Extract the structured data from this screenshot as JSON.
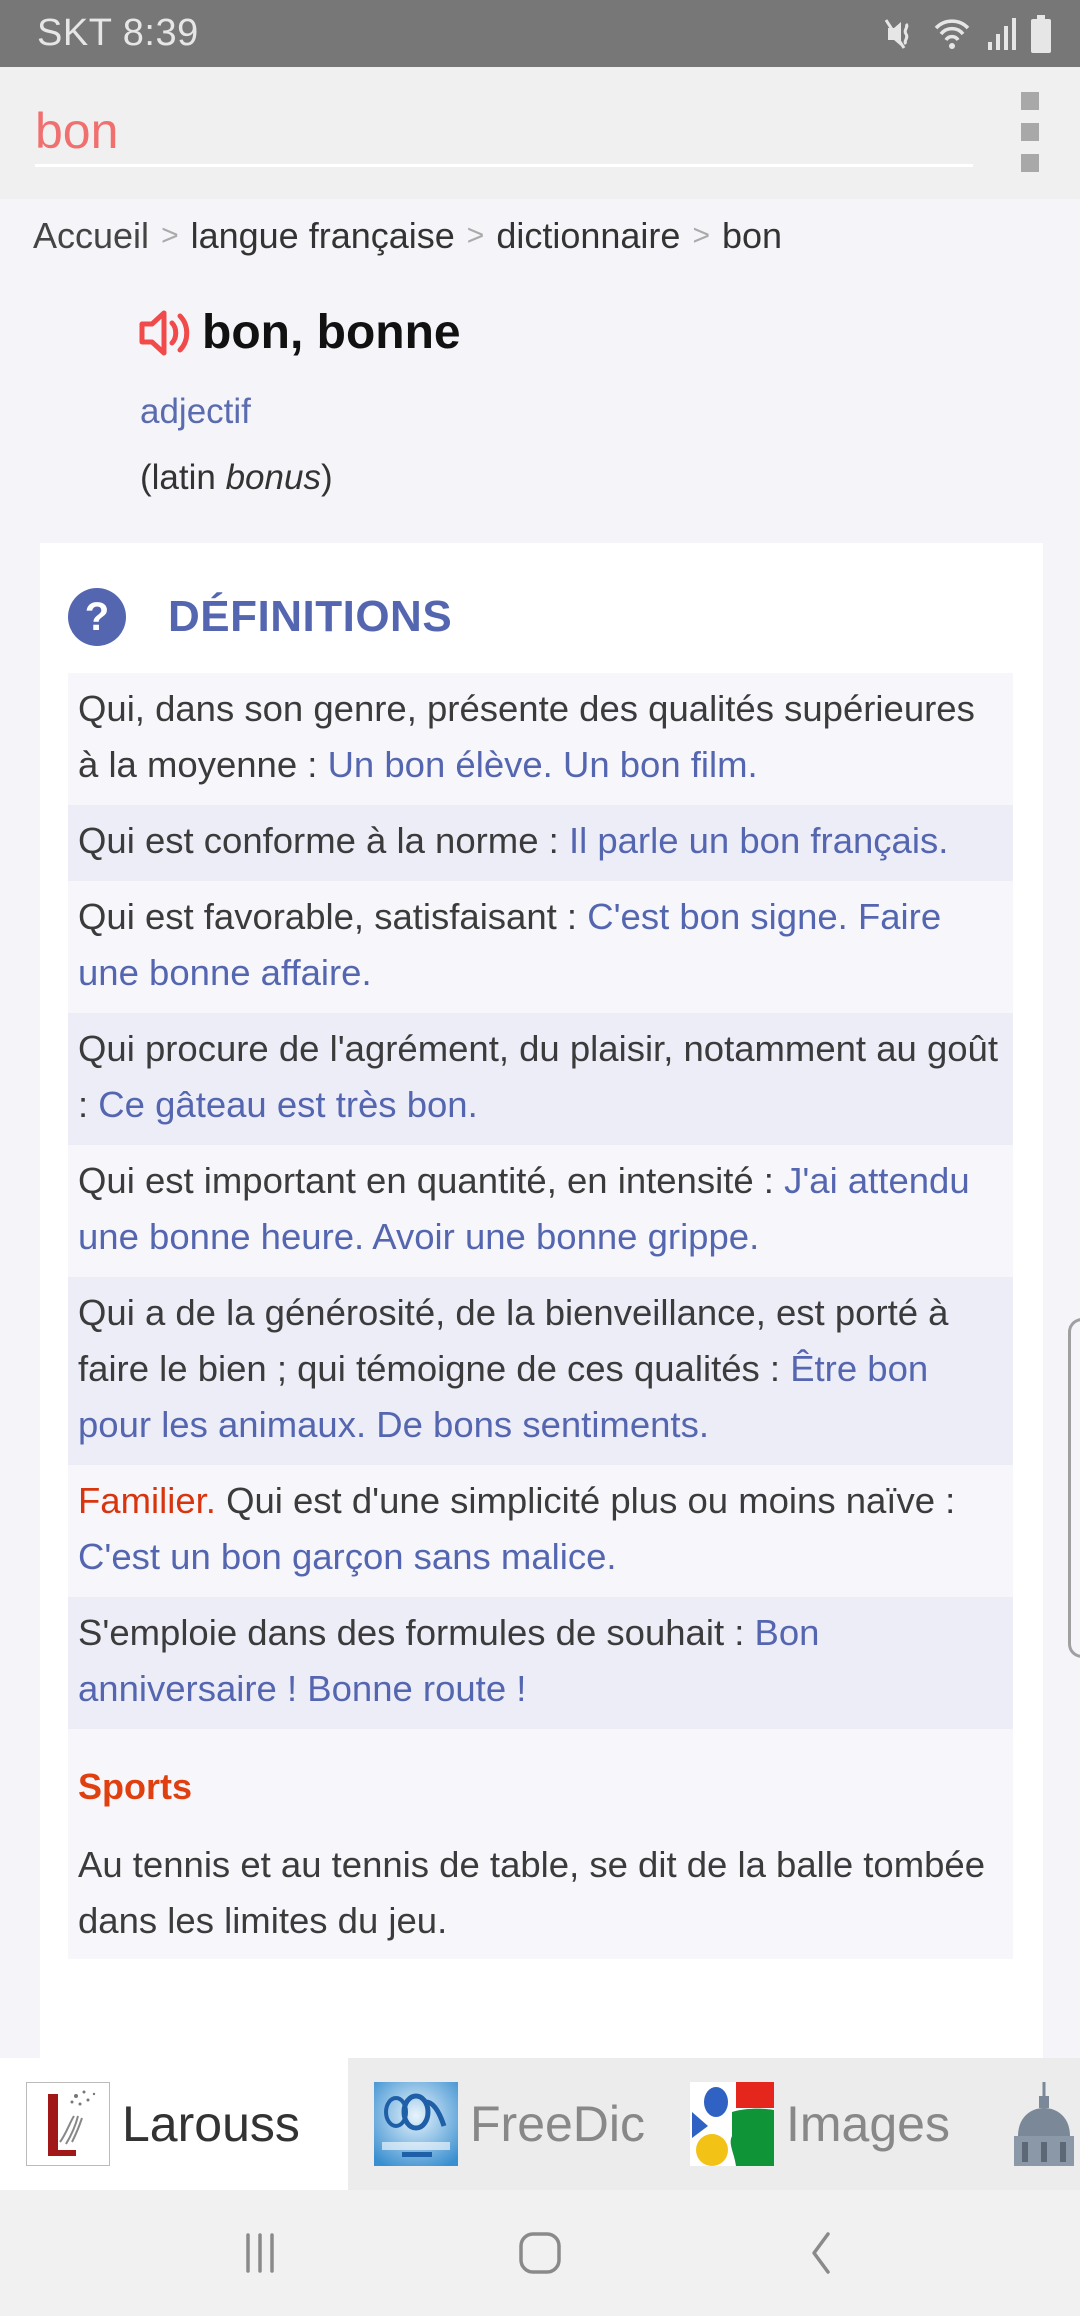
{
  "status_bar": {
    "carrier_time": "SKT 8:39",
    "icons": [
      "vibrate-mute-icon",
      "wifi-icon",
      "signal-icon",
      "battery-icon"
    ]
  },
  "search": {
    "value": "bon",
    "menu_icon": "overflow-menu-icon"
  },
  "breadcrumb": {
    "items": [
      "Accueil",
      "langue française",
      "dictionnaire",
      "bon"
    ],
    "separator": ">"
  },
  "entry": {
    "headword": "bon, bonne",
    "speaker_icon": "speaker-icon",
    "part_of_speech": "adjectif",
    "etymology_prefix": "(latin ",
    "etymology_word": "bonus",
    "etymology_suffix": ")"
  },
  "definitions": {
    "title": "DÉFINITIONS",
    "icon": "question-icon",
    "items": [
      {
        "tag": "",
        "text": "Qui, dans son genre, présente des qualités supérieures à la moyenne : ",
        "example": "Un bon élève. Un bon film."
      },
      {
        "tag": "",
        "text": "Qui est conforme à la norme : ",
        "example": "Il parle un bon français."
      },
      {
        "tag": "",
        "text": "Qui est favorable, satisfaisant : ",
        "example": "C'est bon signe. Faire une bonne affaire."
      },
      {
        "tag": "",
        "text": "Qui procure de l'agrément, du plaisir, notamment au goût : ",
        "example": "Ce gâteau est très bon."
      },
      {
        "tag": "",
        "text": "Qui est important en quantité, en intensité : ",
        "example": "J'ai attendu une bonne heure. Avoir une bonne grippe."
      },
      {
        "tag": "",
        "text": "Qui a de la générosité, de la bienveillance, est porté à faire le bien ; qui témoigne de ces qualités : ",
        "example": "Être bon pour les animaux. De bons sentiments."
      },
      {
        "tag": "Familier.",
        "text": " Qui est d'une simplicité plus ou moins naïve : ",
        "example": "C'est un bon garçon sans malice."
      },
      {
        "tag": "",
        "text": "S'emploie dans des formules de souhait : ",
        "example": "Bon anniversaire ! Bonne route !"
      }
    ],
    "domain": {
      "label": "Sports",
      "text": "Au tennis et au tennis de table, se dit de la balle tombée dans les limites du jeu."
    }
  },
  "source_tabs": [
    {
      "label": "Larouss",
      "icon": "larousse-logo-icon",
      "active": true
    },
    {
      "label": "FreeDic",
      "icon": "freedictionary-logo-icon",
      "active": false
    },
    {
      "label": "Images",
      "icon": "google-images-logo-icon",
      "active": false
    },
    {
      "label": "",
      "icon": "academie-dome-icon",
      "active": false
    }
  ],
  "nav_bar": {
    "buttons": [
      "recent-apps",
      "home",
      "back"
    ]
  },
  "colors": {
    "accent_blue": "#5566b0",
    "search_text": "#f07070",
    "tag_red": "#d8350f",
    "domain_orange": "#e04010",
    "speaker_red": "#f04a4a"
  }
}
